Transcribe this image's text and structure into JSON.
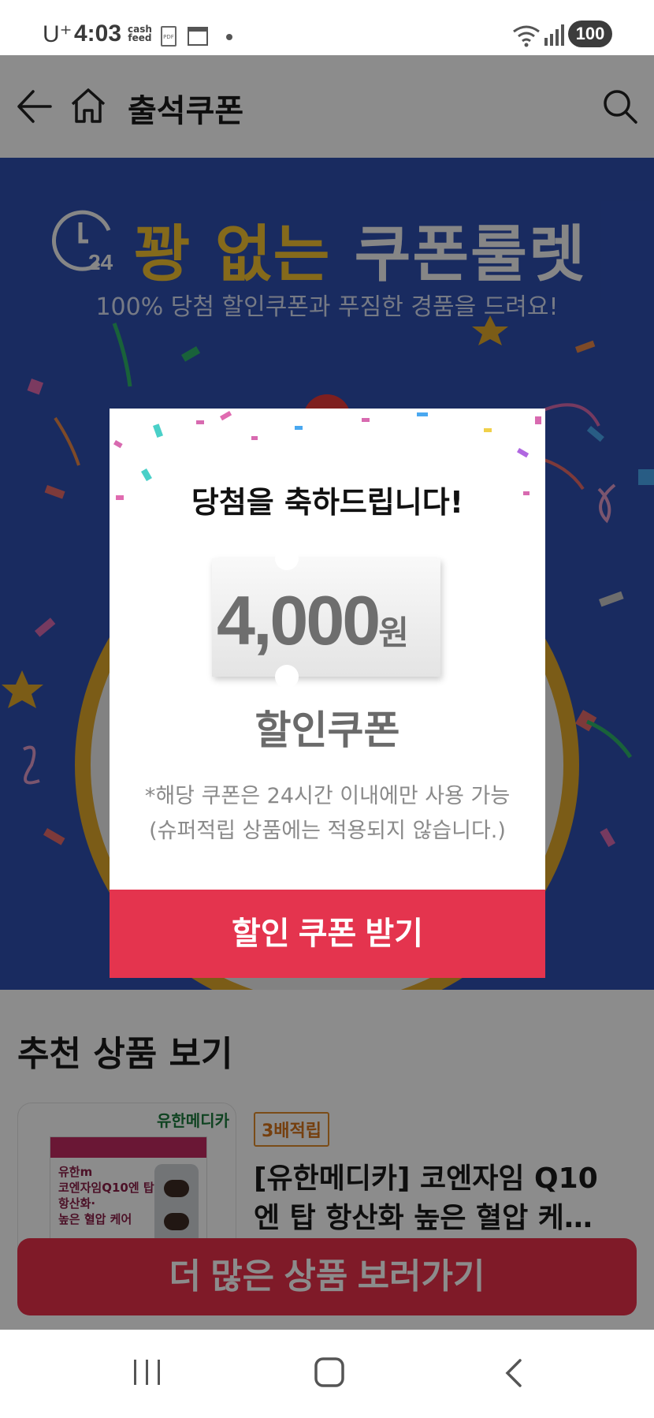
{
  "status_bar": {
    "carrier": "U⁺",
    "time": "4:03",
    "cash_line1": "cash",
    "cash_line2": "feed",
    "pdf": "PDF",
    "battery": "100"
  },
  "header": {
    "title": "출석쿠폰"
  },
  "banner": {
    "clock_number": "24",
    "title_gold": "꽝 없는 ",
    "title_white": "쿠폰룰렛",
    "subtitle": "100% 당첨 할인쿠폰과 푸짐한 경품을 드려요!"
  },
  "modal": {
    "title": "당첨을 축하드립니다!",
    "coupon_amount": "4,000",
    "coupon_unit": "원",
    "coupon_label": "할인쿠폰",
    "note_line1": "*해당 쿠폰은 24시간 이내에만 사용 가능",
    "note_line2": "(슈퍼적립 상품에는 적용되지 않습니다.)",
    "cta": "할인 쿠폰 받기"
  },
  "recommend": {
    "section_title": "추천 상품 보기",
    "product": {
      "brand": "유한메디카",
      "badge": "3배적립",
      "name_line1": "[유한메디카] 코엔자임 Q10",
      "name_line2": "엔 탑 항산화 높은 혈압 케…",
      "box_text": "유한m\n코엔자임Q10엔 탑\n항산화·\n높은 혈압 케어"
    },
    "more_button": "더 많은 상품 보러가기"
  },
  "colors": {
    "banner_bg": "#2e4fb0",
    "gold": "#f3c232",
    "cta_red": "#e4344e",
    "badge_orange": "#d5731b"
  },
  "icons": {
    "back": "back-arrow-icon",
    "home": "home-icon",
    "search": "search-icon",
    "nav_recents": "recents-icon",
    "nav_home": "nav-home-icon",
    "nav_back": "nav-back-icon"
  }
}
